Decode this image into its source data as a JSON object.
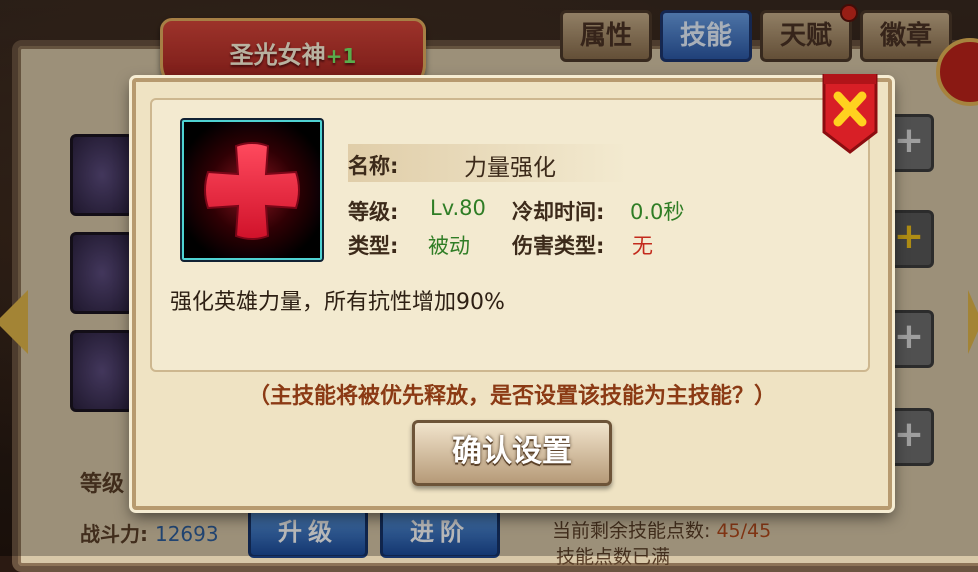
{
  "hero": {
    "name": "圣光女神",
    "plus": "+1"
  },
  "tabs": [
    {
      "label": "属性",
      "active": false
    },
    {
      "label": "技能",
      "active": true
    },
    {
      "label": "天赋",
      "active": false,
      "badge": true
    },
    {
      "label": "徽章",
      "active": false
    }
  ],
  "bottom": {
    "level_label": "等级",
    "power_label": "战斗力:",
    "power_value": "12693",
    "upgrade_label": "升级",
    "advance_label": "进阶",
    "points_label": "当前剩余技能点数:",
    "points_value": "45/45",
    "points_full": "技能点数已满"
  },
  "dialog": {
    "name_label": "名称:",
    "name_value": "力量强化",
    "level_label": "等级:",
    "level_value": "Lv.80",
    "cooldown_label": "冷却时间:",
    "cooldown_value": "0.0秒",
    "type_label": "类型:",
    "type_value": "被动",
    "damage_label": "伤害类型:",
    "damage_value": "无",
    "description": "强化英雄力量，所有抗性增加90%",
    "prompt": "（主技能将被优先释放，是否设置该技能为主技能？）",
    "confirm_label": "确认设置",
    "close_icon": "x-close-icon",
    "skill_icon": "red-cross-icon"
  },
  "colors": {
    "green_value": "#2f7d25",
    "red_value": "#c32a1c",
    "prompt": "#8b3a14",
    "active_tab": "#2d5aa8"
  }
}
